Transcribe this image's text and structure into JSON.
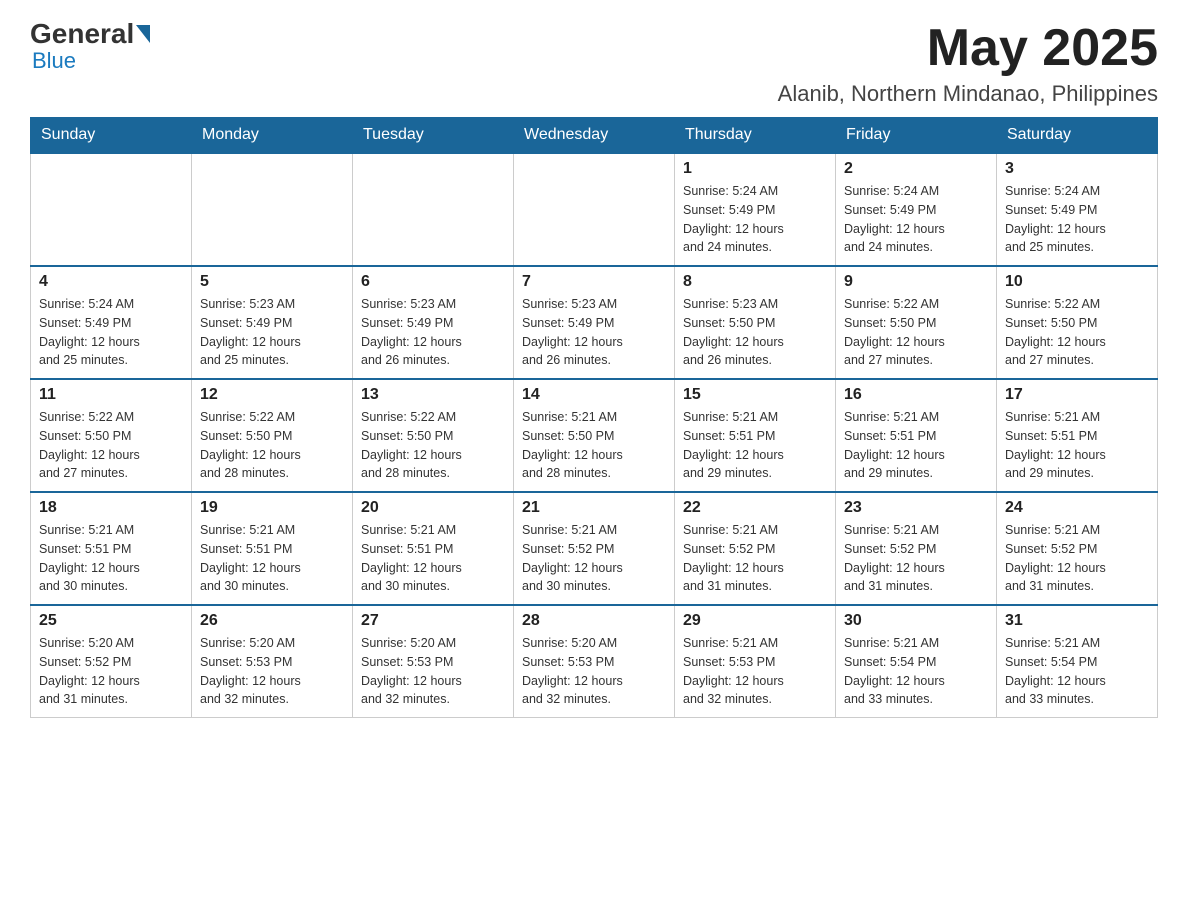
{
  "header": {
    "logo": {
      "general": "General",
      "blue": "Blue"
    },
    "month_year": "May 2025",
    "location": "Alanib, Northern Mindanao, Philippines"
  },
  "days_of_week": [
    "Sunday",
    "Monday",
    "Tuesday",
    "Wednesday",
    "Thursday",
    "Friday",
    "Saturday"
  ],
  "weeks": [
    [
      {
        "day": "",
        "info": ""
      },
      {
        "day": "",
        "info": ""
      },
      {
        "day": "",
        "info": ""
      },
      {
        "day": "",
        "info": ""
      },
      {
        "day": "1",
        "info": "Sunrise: 5:24 AM\nSunset: 5:49 PM\nDaylight: 12 hours\nand 24 minutes."
      },
      {
        "day": "2",
        "info": "Sunrise: 5:24 AM\nSunset: 5:49 PM\nDaylight: 12 hours\nand 24 minutes."
      },
      {
        "day": "3",
        "info": "Sunrise: 5:24 AM\nSunset: 5:49 PM\nDaylight: 12 hours\nand 25 minutes."
      }
    ],
    [
      {
        "day": "4",
        "info": "Sunrise: 5:24 AM\nSunset: 5:49 PM\nDaylight: 12 hours\nand 25 minutes."
      },
      {
        "day": "5",
        "info": "Sunrise: 5:23 AM\nSunset: 5:49 PM\nDaylight: 12 hours\nand 25 minutes."
      },
      {
        "day": "6",
        "info": "Sunrise: 5:23 AM\nSunset: 5:49 PM\nDaylight: 12 hours\nand 26 minutes."
      },
      {
        "day": "7",
        "info": "Sunrise: 5:23 AM\nSunset: 5:49 PM\nDaylight: 12 hours\nand 26 minutes."
      },
      {
        "day": "8",
        "info": "Sunrise: 5:23 AM\nSunset: 5:50 PM\nDaylight: 12 hours\nand 26 minutes."
      },
      {
        "day": "9",
        "info": "Sunrise: 5:22 AM\nSunset: 5:50 PM\nDaylight: 12 hours\nand 27 minutes."
      },
      {
        "day": "10",
        "info": "Sunrise: 5:22 AM\nSunset: 5:50 PM\nDaylight: 12 hours\nand 27 minutes."
      }
    ],
    [
      {
        "day": "11",
        "info": "Sunrise: 5:22 AM\nSunset: 5:50 PM\nDaylight: 12 hours\nand 27 minutes."
      },
      {
        "day": "12",
        "info": "Sunrise: 5:22 AM\nSunset: 5:50 PM\nDaylight: 12 hours\nand 28 minutes."
      },
      {
        "day": "13",
        "info": "Sunrise: 5:22 AM\nSunset: 5:50 PM\nDaylight: 12 hours\nand 28 minutes."
      },
      {
        "day": "14",
        "info": "Sunrise: 5:21 AM\nSunset: 5:50 PM\nDaylight: 12 hours\nand 28 minutes."
      },
      {
        "day": "15",
        "info": "Sunrise: 5:21 AM\nSunset: 5:51 PM\nDaylight: 12 hours\nand 29 minutes."
      },
      {
        "day": "16",
        "info": "Sunrise: 5:21 AM\nSunset: 5:51 PM\nDaylight: 12 hours\nand 29 minutes."
      },
      {
        "day": "17",
        "info": "Sunrise: 5:21 AM\nSunset: 5:51 PM\nDaylight: 12 hours\nand 29 minutes."
      }
    ],
    [
      {
        "day": "18",
        "info": "Sunrise: 5:21 AM\nSunset: 5:51 PM\nDaylight: 12 hours\nand 30 minutes."
      },
      {
        "day": "19",
        "info": "Sunrise: 5:21 AM\nSunset: 5:51 PM\nDaylight: 12 hours\nand 30 minutes."
      },
      {
        "day": "20",
        "info": "Sunrise: 5:21 AM\nSunset: 5:51 PM\nDaylight: 12 hours\nand 30 minutes."
      },
      {
        "day": "21",
        "info": "Sunrise: 5:21 AM\nSunset: 5:52 PM\nDaylight: 12 hours\nand 30 minutes."
      },
      {
        "day": "22",
        "info": "Sunrise: 5:21 AM\nSunset: 5:52 PM\nDaylight: 12 hours\nand 31 minutes."
      },
      {
        "day": "23",
        "info": "Sunrise: 5:21 AM\nSunset: 5:52 PM\nDaylight: 12 hours\nand 31 minutes."
      },
      {
        "day": "24",
        "info": "Sunrise: 5:21 AM\nSunset: 5:52 PM\nDaylight: 12 hours\nand 31 minutes."
      }
    ],
    [
      {
        "day": "25",
        "info": "Sunrise: 5:20 AM\nSunset: 5:52 PM\nDaylight: 12 hours\nand 31 minutes."
      },
      {
        "day": "26",
        "info": "Sunrise: 5:20 AM\nSunset: 5:53 PM\nDaylight: 12 hours\nand 32 minutes."
      },
      {
        "day": "27",
        "info": "Sunrise: 5:20 AM\nSunset: 5:53 PM\nDaylight: 12 hours\nand 32 minutes."
      },
      {
        "day": "28",
        "info": "Sunrise: 5:20 AM\nSunset: 5:53 PM\nDaylight: 12 hours\nand 32 minutes."
      },
      {
        "day": "29",
        "info": "Sunrise: 5:21 AM\nSunset: 5:53 PM\nDaylight: 12 hours\nand 32 minutes."
      },
      {
        "day": "30",
        "info": "Sunrise: 5:21 AM\nSunset: 5:54 PM\nDaylight: 12 hours\nand 33 minutes."
      },
      {
        "day": "31",
        "info": "Sunrise: 5:21 AM\nSunset: 5:54 PM\nDaylight: 12 hours\nand 33 minutes."
      }
    ]
  ]
}
